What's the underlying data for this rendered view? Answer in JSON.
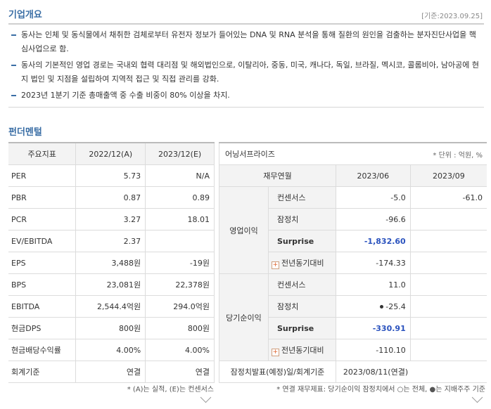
{
  "overview": {
    "title": "기업개요",
    "date_note": "[기준:2023.09.25]",
    "items": [
      "동사는 인체 및 동식물에서 채취한 검체로부터 유전자 정보가 들어있는 DNA 및 RNA 분석을 통해 질환의 원인을 검출하는 분자진단사업을 핵심사업으로 함.",
      "동사의 기본적인 영업 경로는 국내외 협력 대리점 및 해외법인으로, 이탈리아, 중동, 미국, 캐나다, 독일, 브라질, 멕시코, 콜롬비아, 남아공에 현지 법인 및 지점을 설립하여 지역적 접근 및 직접 관리를 강화.",
      "2023년 1분기 기준 총매출액 중 수출 비중이 80% 이상을 차지."
    ]
  },
  "fundamentals": {
    "title": "펀더멘털",
    "headers": [
      "주요지표",
      "2022/12(A)",
      "2023/12(E)"
    ],
    "rows": [
      {
        "label": "PER",
        "a": "5.73",
        "e": "N/A"
      },
      {
        "label": "PBR",
        "a": "0.87",
        "e": "0.89"
      },
      {
        "label": "PCR",
        "a": "3.27",
        "e": "18.01"
      },
      {
        "label": "EV/EBITDA",
        "a": "2.37",
        "e": ""
      },
      {
        "label": "EPS",
        "a": "3,488원",
        "e": "-19원"
      },
      {
        "label": "BPS",
        "a": "23,081원",
        "e": "22,378원"
      },
      {
        "label": "EBITDA",
        "a": "2,544.4억원",
        "e": "294.0억원"
      },
      {
        "label": "현금DPS",
        "a": "800원",
        "e": "800원"
      },
      {
        "label": "현금배당수익률",
        "a": "4.00%",
        "e": "4.00%"
      },
      {
        "label": "회계기준",
        "a": "연결",
        "e": "연결"
      }
    ],
    "footnote": "* (A)는 실적, (E)는 컨센서스"
  },
  "earnings": {
    "title": "어닝서프라이즈",
    "unit": "* 단위 : 억원, %",
    "headers": [
      "재무연월",
      "2023/06",
      "2023/09"
    ],
    "groups": [
      {
        "name": "영업이익",
        "rows": [
          {
            "label": "컨센서스",
            "v1": "-5.0",
            "v2": "-61.0"
          },
          {
            "label": "잠정치",
            "v1": "-96.6",
            "v2": ""
          },
          {
            "label": "Surprise",
            "v1": "-1,832.60",
            "v2": ""
          },
          {
            "label": "전년동기대비",
            "v1": "-174.33",
            "v2": ""
          }
        ]
      },
      {
        "name": "당기순이익",
        "rows": [
          {
            "label": "컨센서스",
            "v1": "11.0",
            "v2": ""
          },
          {
            "label": "잠정치",
            "v1": "-25.4",
            "v2": ""
          },
          {
            "label": "Surprise",
            "v1": "-330.91",
            "v2": ""
          },
          {
            "label": "전년동기대비",
            "v1": "-110.10",
            "v2": ""
          }
        ]
      }
    ],
    "announce": {
      "label": "잠정치발표(예정)일/회계기준",
      "value": "2023/08/11(연결)"
    },
    "footnote": "* 연결 재무제표: 당기순이익 잠정치에서 ○는 전체, ●는 지배주주 기준"
  }
}
